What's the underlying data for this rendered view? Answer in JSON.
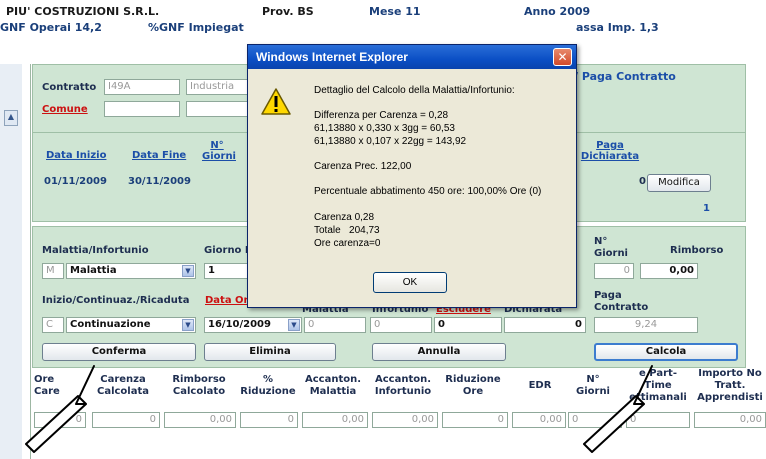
{
  "header": {
    "company": "PIU' COSTRUZIONI S.R.L.",
    "prov": "Prov. BS",
    "mese": "Mese 11",
    "anno": "Anno 2009",
    "gnf_operai": "GNF Operai 14,2",
    "gnf_impiegati": "%GNF Impiegat",
    "cassa_imp": "assa Imp. 1,3"
  },
  "contract": {
    "contratto_label": "Contratto",
    "contratto_value": "I49A",
    "settore_value": "Industria",
    "comune_label": "Comune",
    "paga_contratto_label": "/ Paga Contratto"
  },
  "period": {
    "headers": [
      "Data Inizio",
      "Data Fine",
      "N° Giorni",
      "Paga Dichiarata"
    ],
    "row": {
      "data_inizio": "01/11/2009",
      "data_fine": "30/11/2009",
      "paga_value": "0"
    },
    "modifica_label": "Modifica",
    "page_num": "1"
  },
  "event": {
    "malattia_label": "Malattia/Infortunio",
    "giorno_label": "Giorno D",
    "type_code": "M",
    "type_value": "Malattia",
    "day_value": "1",
    "n_giorni_label": "N° Giorni",
    "rimborso_label": "Rimborso",
    "n_giorni_value": "0",
    "rimborso_value": "0,00",
    "inizio_label": "Inizio/Continuaz./Ricaduta",
    "data_or_label": "Data Or",
    "malattia_col": "Malattia",
    "infortunio_col": "Infortunio",
    "escludere_col": "Escludere",
    "dichiarata_col": "Dichiarata",
    "paga_contratto_label": "Paga Contratto",
    "cont_code": "C",
    "cont_value": "Continuazione",
    "date_value": "16/10/2009",
    "f_malattia": "0",
    "f_infortunio": "0",
    "f_escludere": "0",
    "f_dichiarata": "0",
    "f_paga": "9,24"
  },
  "buttons": {
    "conferma": "Conferma",
    "elimina": "Elimina",
    "annulla": "Annulla",
    "calcola": "Calcola"
  },
  "results": {
    "headers": [
      "Ore Carenza",
      "Carenza Calcolata",
      "Rimborso Calcolato",
      "% Riduzione",
      "Accanton. Malattia",
      "Accanton. Infortunio",
      "Riduzione Ore",
      "EDR",
      "N° Giorni",
      "Ore Part-Time Settimanali",
      "Importo Non Tratt. Apprendisti"
    ],
    "h_ore": "Ore\nCare",
    "h_carenza": "Carenza\nCalcolata",
    "h_rimborso": "Rimborso\nCalcolato",
    "h_riduzione": "%\nRiduzione",
    "h_acc_mal": "Accanton.\nMalattia",
    "h_acc_inf": "Accanton.\nInfortunio",
    "h_rid_ore": "Riduzione\nOre",
    "h_edr": "EDR",
    "h_giorni": "N°\nGiorni",
    "h_parttime": "e Part-\nTime\nettimanali",
    "h_importo": "Importo No\nTratt.\nApprendisti",
    "v_ore": "0",
    "v_carenza": "0",
    "v_rimborso": "0,00",
    "v_riduzione": "0",
    "v_acc_mal": "0,00",
    "v_acc_inf": "0,00",
    "v_rid_ore": "0",
    "v_edr": "0,00",
    "v_giorni": "0",
    "v_parttime": "0",
    "v_importo": "0,00"
  },
  "dialog": {
    "title": "Windows Internet Explorer",
    "close": "✕",
    "icon": "warning-icon",
    "lines": [
      "Dettaglio del Calcolo della Malattia/Infortunio:",
      "Differenza per Carenza = 0,28",
      "61,13880 x 0,330 x 3gg = 60,53",
      "61,13880 x 0,107 x 22gg = 143,92",
      "Carenza Prec. 122,00",
      "Percentuale abbatimento 450 ore: 100,00% Ore (0)",
      "Carenza 0,28",
      "Totale   204,73",
      "Ore carenza=0"
    ],
    "ok": "OK"
  }
}
